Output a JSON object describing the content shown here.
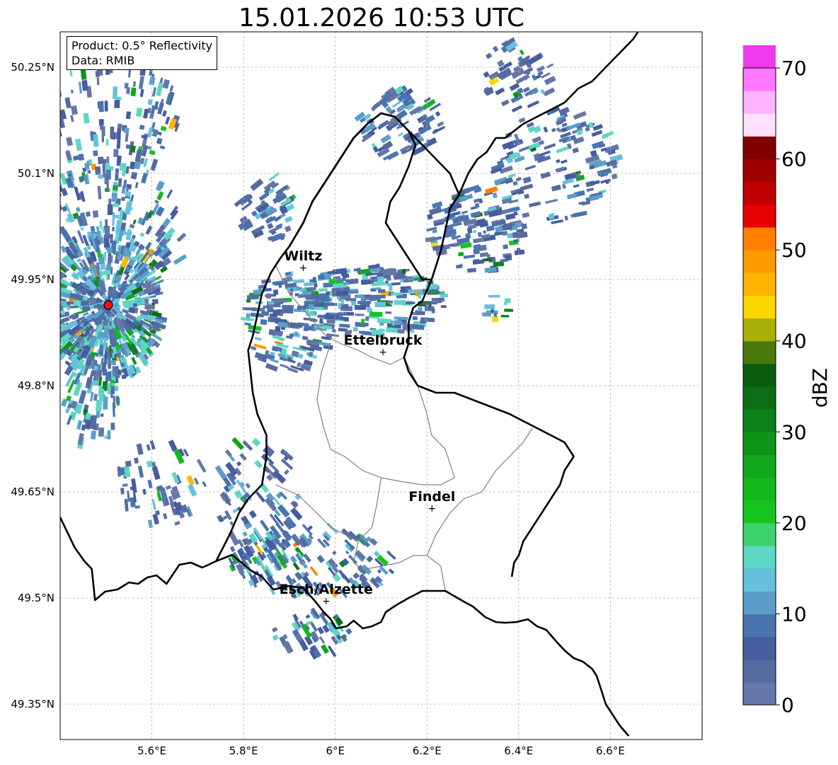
{
  "title": "15.01.2026 10:53 UTC",
  "info": {
    "product": "Product: 0.5° Reflectivity",
    "data": "Data: RMIB"
  },
  "map": {
    "lon_range": [
      5.4,
      6.8
    ],
    "lat_range": [
      49.3,
      50.3
    ],
    "x_ticks": [
      {
        "value": 5.6,
        "label": "5.6°E"
      },
      {
        "value": 5.8,
        "label": "5.8°E"
      },
      {
        "value": 6.0,
        "label": "6°E"
      },
      {
        "value": 6.2,
        "label": "6.2°E"
      },
      {
        "value": 6.4,
        "label": "6.4°E"
      },
      {
        "value": 6.6,
        "label": "6.6°E"
      }
    ],
    "y_ticks": [
      {
        "value": 49.35,
        "label": "49.35°N"
      },
      {
        "value": 49.5,
        "label": "49.5°N"
      },
      {
        "value": 49.65,
        "label": "49.65°N"
      },
      {
        "value": 49.8,
        "label": "49.8°N"
      },
      {
        "value": 49.95,
        "label": "49.95°N"
      },
      {
        "value": 50.1,
        "label": "50.1°N"
      },
      {
        "value": 50.25,
        "label": "50.25°N"
      }
    ],
    "gridlines": true,
    "cities": [
      {
        "name": "Wiltz",
        "lon": 5.93,
        "lat": 49.967
      },
      {
        "name": "Ettelbruck",
        "lon": 6.104,
        "lat": 49.848
      },
      {
        "name": "Findel",
        "lon": 6.211,
        "lat": 49.627
      },
      {
        "name": "Esch/Alzette",
        "lon": 5.98,
        "lat": 49.496
      }
    ],
    "radar_site": {
      "lon": 5.505,
      "lat": 49.914,
      "color": "#ee1111"
    },
    "borders": {
      "national": [
        [
          [
            5.4,
            49.614
          ],
          [
            5.432,
            49.571
          ],
          [
            5.453,
            49.552
          ],
          [
            5.469,
            49.541
          ],
          [
            5.476,
            49.497
          ],
          [
            5.498,
            49.509
          ],
          [
            5.525,
            49.512
          ],
          [
            5.55,
            49.522
          ],
          [
            5.57,
            49.52
          ],
          [
            5.59,
            49.529
          ],
          [
            5.61,
            49.532
          ],
          [
            5.632,
            49.52
          ],
          [
            5.66,
            49.547
          ],
          [
            5.685,
            49.55
          ],
          [
            5.71,
            49.543
          ],
          [
            5.74,
            49.552
          ],
          [
            5.775,
            49.561
          ],
          [
            5.816,
            49.539
          ],
          [
            5.84,
            49.53
          ],
          [
            5.865,
            49.512
          ],
          [
            5.9,
            49.517
          ],
          [
            5.93,
            49.514
          ],
          [
            5.954,
            49.497
          ],
          [
            5.975,
            49.48
          ],
          [
            5.99,
            49.47
          ],
          [
            6.002,
            49.457
          ],
          [
            6.025,
            49.46
          ],
          [
            6.04,
            49.468
          ],
          [
            6.06,
            49.457
          ],
          [
            6.08,
            49.46
          ],
          [
            6.1,
            49.466
          ],
          [
            6.11,
            49.48
          ],
          [
            6.133,
            49.49
          ],
          [
            6.16,
            49.5
          ],
          [
            6.19,
            49.51
          ],
          [
            6.24,
            49.51
          ],
          [
            6.28,
            49.495
          ],
          [
            6.3,
            49.488
          ],
          [
            6.327,
            49.473
          ],
          [
            6.35,
            49.466
          ],
          [
            6.37,
            49.465
          ],
          [
            6.395,
            49.466
          ],
          [
            6.42,
            49.47
          ],
          [
            6.44,
            49.46
          ],
          [
            6.46,
            49.455
          ],
          [
            6.48,
            49.44
          ],
          [
            6.5,
            49.426
          ],
          [
            6.52,
            49.415
          ],
          [
            6.54,
            49.41
          ],
          [
            6.56,
            49.4
          ],
          [
            6.57,
            49.39
          ],
          [
            6.58,
            49.37
          ],
          [
            6.59,
            49.35
          ],
          [
            6.6,
            49.34
          ],
          [
            6.62,
            49.32
          ],
          [
            6.64,
            49.305
          ]
        ],
        [
          [
            6.66,
            50.3
          ],
          [
            6.65,
            50.29
          ],
          [
            6.62,
            50.27
          ],
          [
            6.59,
            50.25
          ],
          [
            6.56,
            50.23
          ],
          [
            6.53,
            50.22
          ],
          [
            6.5,
            50.2
          ],
          [
            6.47,
            50.19
          ],
          [
            6.44,
            50.18
          ],
          [
            6.41,
            50.17
          ],
          [
            6.39,
            50.16
          ],
          [
            6.37,
            50.15
          ],
          [
            6.35,
            50.15
          ],
          [
            6.33,
            50.13
          ],
          [
            6.31,
            50.12
          ],
          [
            6.29,
            50.1
          ],
          [
            6.27,
            50.07
          ],
          [
            6.25,
            50.05
          ],
          [
            6.24,
            50.02
          ],
          [
            6.23,
            49.99
          ],
          [
            6.21,
            49.95
          ],
          [
            6.19,
            49.92
          ],
          [
            6.17,
            49.91
          ],
          [
            6.16,
            49.89
          ],
          [
            6.16,
            49.86
          ],
          [
            6.15,
            49.84
          ],
          [
            6.16,
            49.82
          ],
          [
            6.18,
            49.8
          ],
          [
            6.22,
            49.79
          ],
          [
            6.26,
            49.79
          ],
          [
            6.3,
            49.78
          ],
          [
            6.34,
            49.77
          ],
          [
            6.38,
            49.76
          ],
          [
            6.41,
            49.75
          ],
          [
            6.44,
            49.74
          ],
          [
            6.47,
            49.73
          ],
          [
            6.5,
            49.72
          ],
          [
            6.52,
            49.7
          ],
          [
            6.5,
            49.68
          ],
          [
            6.49,
            49.66
          ],
          [
            6.47,
            49.64
          ],
          [
            6.45,
            49.62
          ],
          [
            6.43,
            49.6
          ],
          [
            6.41,
            49.58
          ],
          [
            6.4,
            49.56
          ],
          [
            6.39,
            49.55
          ],
          [
            6.385,
            49.53
          ]
        ],
        [
          [
            5.9,
            49.997
          ],
          [
            5.93,
            50.03
          ],
          [
            5.95,
            50.06
          ],
          [
            5.98,
            50.09
          ],
          [
            6.01,
            50.12
          ],
          [
            6.04,
            50.15
          ],
          [
            6.07,
            50.17
          ],
          [
            6.1,
            50.185
          ],
          [
            6.13,
            50.18
          ],
          [
            6.16,
            50.16
          ],
          [
            6.19,
            50.14
          ],
          [
            6.22,
            50.12
          ],
          [
            6.25,
            50.1
          ],
          [
            6.27,
            50.07
          ]
        ]
      ],
      "luxembourg": [
        [
          5.74,
          49.552
        ],
        [
          5.77,
          49.59
        ],
        [
          5.79,
          49.62
        ],
        [
          5.81,
          49.64
        ],
        [
          5.84,
          49.66
        ],
        [
          5.85,
          49.7
        ],
        [
          5.85,
          49.73
        ],
        [
          5.83,
          49.76
        ],
        [
          5.82,
          49.79
        ],
        [
          5.815,
          49.82
        ],
        [
          5.81,
          49.85
        ],
        [
          5.82,
          49.87
        ],
        [
          5.83,
          49.9
        ],
        [
          5.84,
          49.93
        ],
        [
          5.86,
          49.96
        ],
        [
          5.88,
          49.98
        ],
        [
          5.9,
          49.997
        ],
        [
          5.93,
          50.03
        ],
        [
          5.95,
          50.06
        ],
        [
          5.98,
          50.09
        ],
        [
          6.01,
          50.12
        ],
        [
          6.04,
          50.15
        ],
        [
          6.07,
          50.17
        ],
        [
          6.1,
          50.185
        ],
        [
          6.13,
          50.18
        ],
        [
          6.16,
          50.16
        ],
        [
          6.175,
          50.14
        ],
        [
          6.16,
          50.11
        ],
        [
          6.14,
          50.08
        ],
        [
          6.12,
          50.06
        ],
        [
          6.11,
          50.03
        ],
        [
          6.13,
          50.01
        ],
        [
          6.15,
          49.99
        ],
        [
          6.17,
          49.97
        ],
        [
          6.19,
          49.95
        ],
        [
          6.21,
          49.95
        ]
      ],
      "internal_districts": [
        [
          [
            5.87,
            49.97
          ],
          [
            5.9,
            49.93
          ],
          [
            5.94,
            49.9
          ],
          [
            5.98,
            49.87
          ],
          [
            6.01,
            49.86
          ],
          [
            6.05,
            49.85
          ],
          [
            6.08,
            49.84
          ],
          [
            6.12,
            49.83
          ],
          [
            6.15,
            49.84
          ]
        ],
        [
          [
            5.99,
            49.86
          ],
          [
            5.97,
            49.82
          ],
          [
            5.96,
            49.78
          ],
          [
            5.975,
            49.74
          ],
          [
            5.99,
            49.71
          ],
          [
            6.02,
            49.7
          ],
          [
            6.06,
            49.68
          ],
          [
            6.1,
            49.67
          ],
          [
            6.14,
            49.665
          ],
          [
            6.19,
            49.66
          ],
          [
            6.23,
            49.66
          ],
          [
            6.26,
            49.67
          ]
        ],
        [
          [
            6.1,
            49.67
          ],
          [
            6.09,
            49.63
          ],
          [
            6.08,
            49.6
          ],
          [
            6.05,
            49.58
          ],
          [
            6.04,
            49.55
          ],
          [
            6.06,
            49.54
          ],
          [
            6.1,
            49.545
          ],
          [
            6.14,
            49.55
          ],
          [
            6.17,
            49.56
          ],
          [
            6.2,
            49.56
          ],
          [
            6.23,
            49.545
          ],
          [
            6.24,
            49.51
          ]
        ],
        [
          [
            5.87,
            49.66
          ],
          [
            5.92,
            49.645
          ],
          [
            5.96,
            49.62
          ],
          [
            5.99,
            49.6
          ],
          [
            6.02,
            49.59
          ],
          [
            6.05,
            49.58
          ]
        ],
        [
          [
            6.2,
            49.56
          ],
          [
            6.22,
            49.59
          ],
          [
            6.25,
            49.62
          ],
          [
            6.28,
            49.64
          ],
          [
            6.32,
            49.65
          ],
          [
            6.35,
            49.68
          ],
          [
            6.38,
            49.7
          ],
          [
            6.41,
            49.72
          ],
          [
            6.43,
            49.74
          ]
        ],
        [
          [
            6.15,
            49.84
          ],
          [
            6.18,
            49.8
          ],
          [
            6.2,
            49.76
          ],
          [
            6.21,
            49.73
          ],
          [
            6.24,
            49.71
          ],
          [
            6.26,
            49.67
          ]
        ]
      ]
    }
  },
  "colorbar": {
    "label": "dBZ",
    "vmin": 0,
    "vmax": 70,
    "step": 2.5,
    "tick_values": [
      0,
      10,
      20,
      30,
      40,
      50,
      60,
      70
    ],
    "tick_labels": [
      "0",
      "10",
      "20",
      "30",
      "40",
      "50",
      "60",
      "70"
    ],
    "colors": [
      "#6577a8",
      "#566aa2",
      "#465d9f",
      "#4a74af",
      "#5a9fc9",
      "#66c1dc",
      "#5ed6c4",
      "#3bd36b",
      "#14c51d",
      "#12b81c",
      "#11a61b",
      "#0f941a",
      "#0d8118",
      "#0d6d14",
      "#0b5c10",
      "#4a7a0d",
      "#a9b00a",
      "#ffd700",
      "#ffb400",
      "#ff9a00",
      "#ff7f00",
      "#e60000",
      "#c00000",
      "#a00000",
      "#800000",
      "#ffe2ff",
      "#ffb3ff",
      "#ff77ff",
      "#ee3aee"
    ]
  },
  "echo_clusters": [
    {
      "lon": 5.505,
      "lat": 49.914,
      "rlon": 0.12,
      "rlat": 0.11,
      "n": 520,
      "hi": 0.55
    },
    {
      "lon": 5.5,
      "lat": 50.01,
      "rlon": 0.17,
      "rlat": 0.11,
      "n": 240,
      "hi": 0.45
    },
    {
      "lon": 5.52,
      "lat": 50.18,
      "rlon": 0.14,
      "rlat": 0.09,
      "n": 120,
      "hi": 0.25
    },
    {
      "lon": 5.47,
      "lat": 49.83,
      "rlon": 0.07,
      "rlat": 0.12,
      "n": 150,
      "hi": 0.35
    },
    {
      "lon": 5.9,
      "lat": 49.89,
      "rlon": 0.1,
      "rlat": 0.07,
      "n": 170,
      "hi": 0.35
    },
    {
      "lon": 6.08,
      "lat": 49.92,
      "rlon": 0.16,
      "rlat": 0.05,
      "n": 220,
      "hi": 0.35
    },
    {
      "lon": 6.31,
      "lat": 50.02,
      "rlon": 0.11,
      "rlat": 0.06,
      "n": 130,
      "hi": 0.2
    },
    {
      "lon": 6.48,
      "lat": 50.11,
      "rlon": 0.14,
      "rlat": 0.08,
      "n": 140,
      "hi": 0.2
    },
    {
      "lon": 6.4,
      "lat": 50.24,
      "rlon": 0.08,
      "rlat": 0.05,
      "n": 60,
      "hi": 0.15
    },
    {
      "lon": 6.14,
      "lat": 50.17,
      "rlon": 0.09,
      "rlat": 0.05,
      "n": 90,
      "hi": 0.2
    },
    {
      "lon": 5.95,
      "lat": 49.55,
      "rlon": 0.18,
      "rlat": 0.05,
      "n": 160,
      "hi": 0.3
    },
    {
      "lon": 5.83,
      "lat": 49.64,
      "rlon": 0.09,
      "rlat": 0.09,
      "n": 100,
      "hi": 0.25
    },
    {
      "lon": 5.62,
      "lat": 49.66,
      "rlon": 0.1,
      "rlat": 0.06,
      "n": 60,
      "hi": 0.2
    },
    {
      "lon": 5.85,
      "lat": 50.05,
      "rlon": 0.06,
      "rlat": 0.05,
      "n": 60,
      "hi": 0.25
    },
    {
      "lon": 5.95,
      "lat": 49.45,
      "rlon": 0.09,
      "rlat": 0.03,
      "n": 50,
      "hi": 0.3
    },
    {
      "lon": 6.35,
      "lat": 49.91,
      "rlon": 0.03,
      "rlat": 0.02,
      "n": 12,
      "hi": 0.5
    }
  ]
}
